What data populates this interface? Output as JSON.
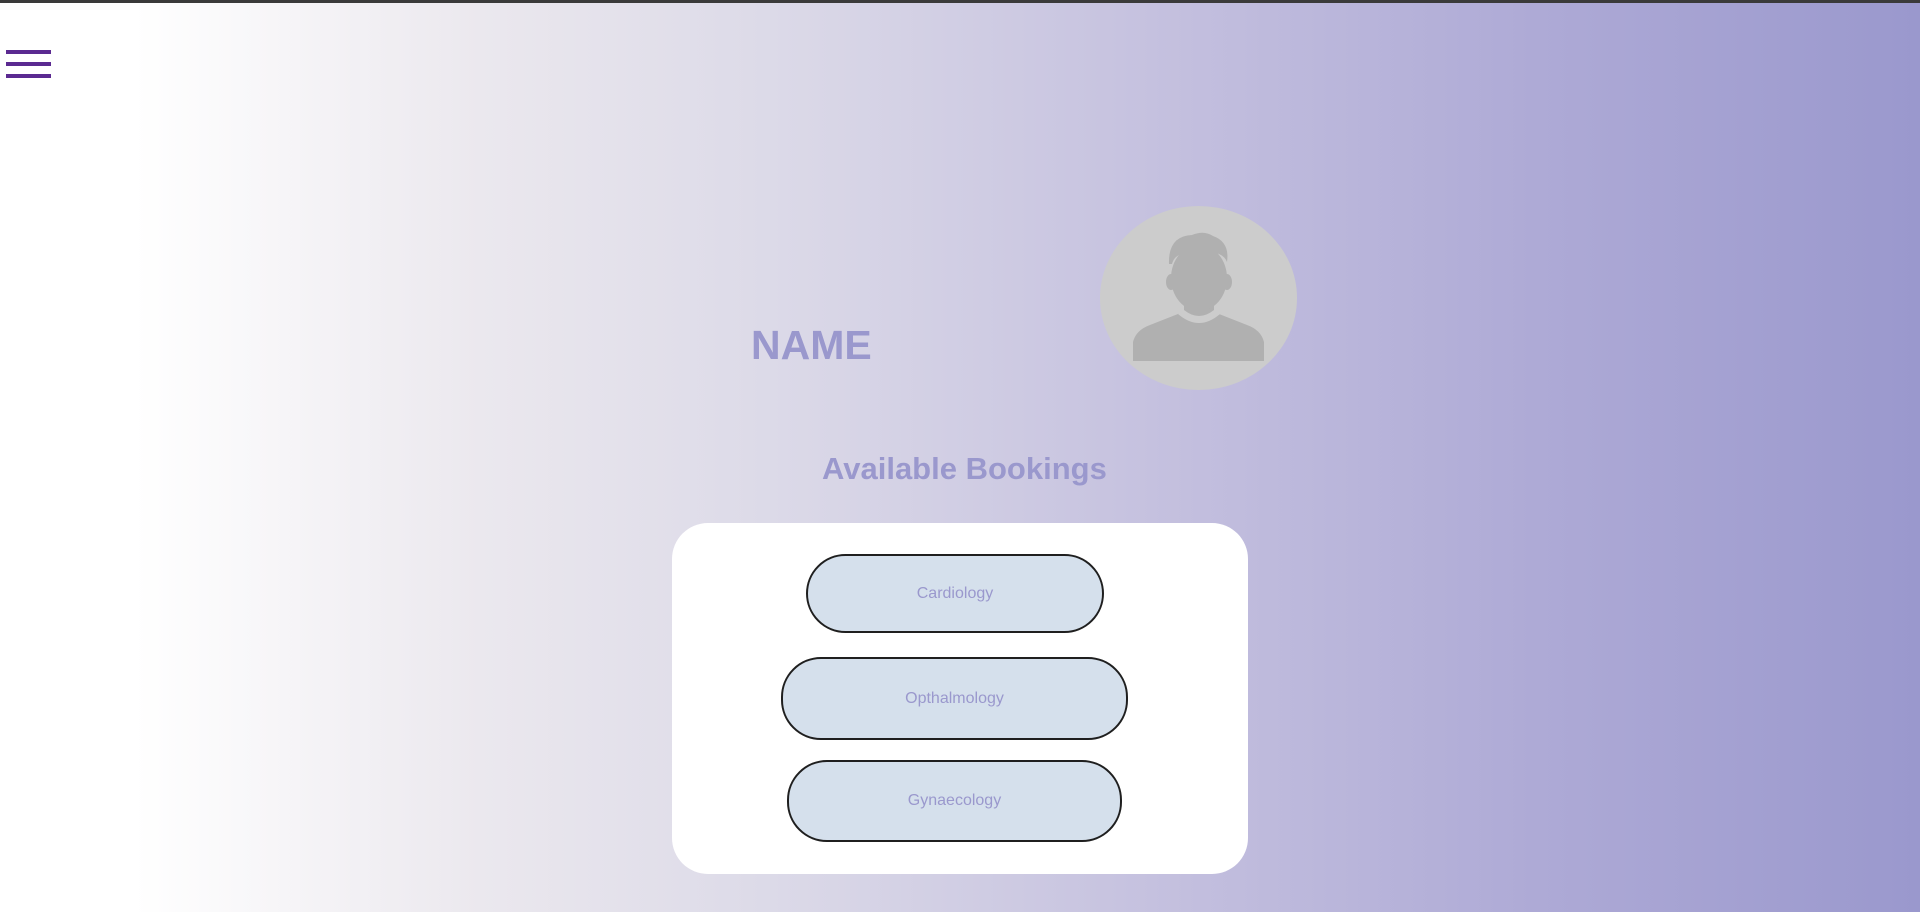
{
  "header": {
    "menu_icon": "hamburger-menu-icon"
  },
  "profile": {
    "name": "NAME",
    "avatar_icon": "user-silhouette-icon"
  },
  "bookings": {
    "title": "Available Bookings",
    "items": [
      {
        "label": "Cardiology"
      },
      {
        "label": "Opthalmology"
      },
      {
        "label": "Gynaecology"
      }
    ]
  },
  "colors": {
    "accent_text": "#9a98cd",
    "menu_icon": "#5b2a91",
    "button_fill": "#d5e0ec",
    "avatar_bg": "#cccccc",
    "avatar_silhouette": "#b0b0b0"
  }
}
